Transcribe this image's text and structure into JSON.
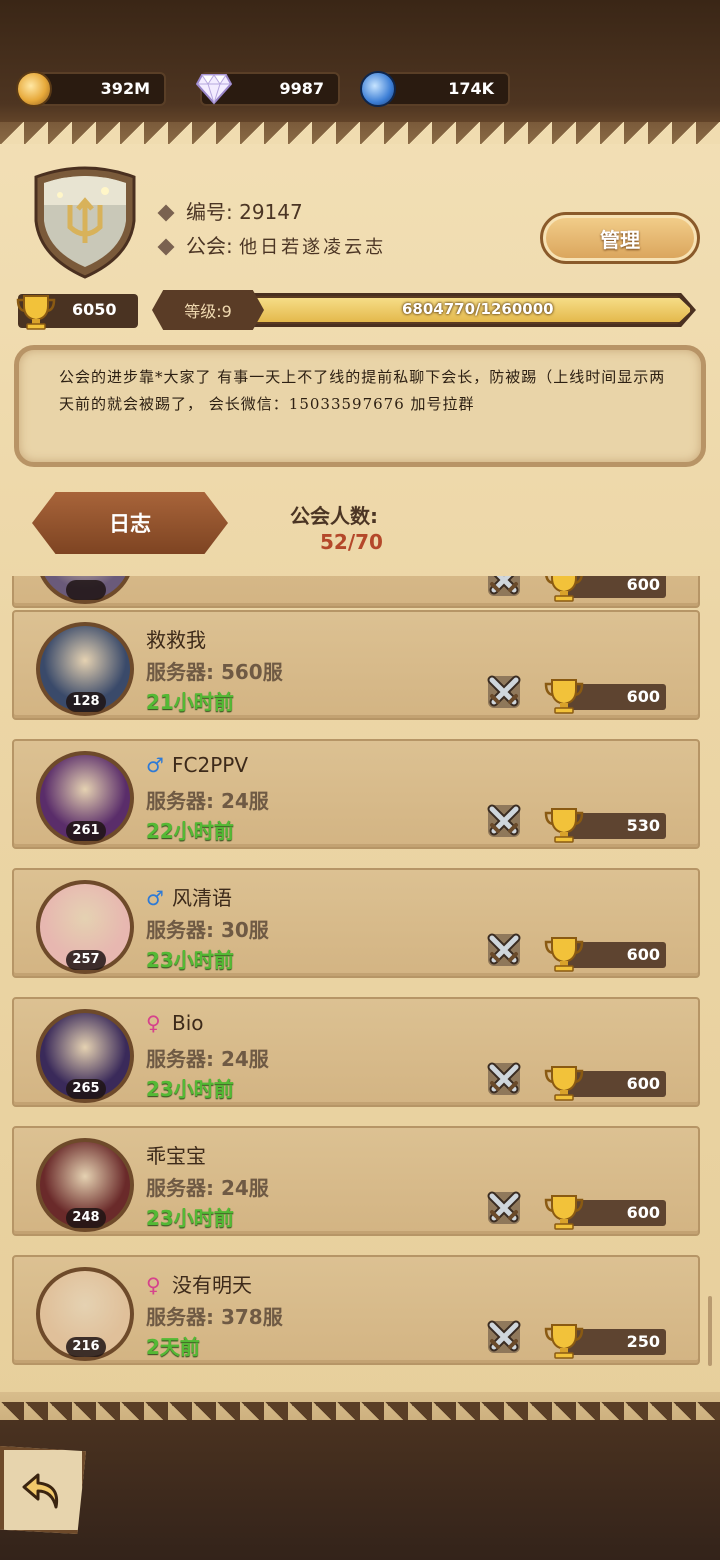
{
  "resources": {
    "coins": "392M",
    "diamonds": "9987",
    "tokens": "174K"
  },
  "guild": {
    "id_label": "编号: 29147",
    "name_label": "公会:",
    "name": "他日若遂凌云志",
    "manage_label": "管理",
    "trophies": "6050",
    "level_label": "等级:9",
    "progress_text": "6804770/1260000",
    "progress_fraction": 1.0,
    "notice": "公会的进步靠*大家了 有事一天上不了线的提前私聊下会长，防被踢（上线时间显示两天前的就会被踢了， 会长微信：15033597676 加号拉群",
    "log_label": "日志",
    "member_count_label": "公会人数:",
    "member_count": "52/70"
  },
  "members": [
    {
      "name": "",
      "gender": "",
      "server": "",
      "time": "",
      "level": "",
      "score": "600",
      "avatar_color": "#6a5a7a"
    },
    {
      "name": "救救我",
      "gender": "",
      "server": "服务器: 560服",
      "time": "21小时前",
      "level": "128",
      "score": "600",
      "avatar_color": "#3a4a6a"
    },
    {
      "name": "FC2PPV",
      "gender": "male",
      "server": "服务器: 24服",
      "time": "22小时前",
      "level": "261",
      "score": "530",
      "avatar_color": "#5a2d6a"
    },
    {
      "name": "风清语",
      "gender": "male",
      "server": "服务器: 30服",
      "time": "23小时前",
      "level": "257",
      "score": "600",
      "avatar_color": "#e7b7b0"
    },
    {
      "name": "Bio",
      "gender": "female",
      "server": "服务器: 24服",
      "time": "23小时前",
      "level": "265",
      "score": "600",
      "avatar_color": "#3a2a5a"
    },
    {
      "name": "乖宝宝",
      "gender": "",
      "server": "服务器: 24服",
      "time": "23小时前",
      "level": "248",
      "score": "600",
      "avatar_color": "#6a2a2a"
    },
    {
      "name": "没有明天",
      "gender": "female",
      "server": "服务器: 378服",
      "time": "2天前",
      "level": "216",
      "score": "250",
      "avatar_color": "#e0c09a"
    }
  ],
  "gender_symbols": {
    "male": "♂",
    "female": "♀"
  }
}
